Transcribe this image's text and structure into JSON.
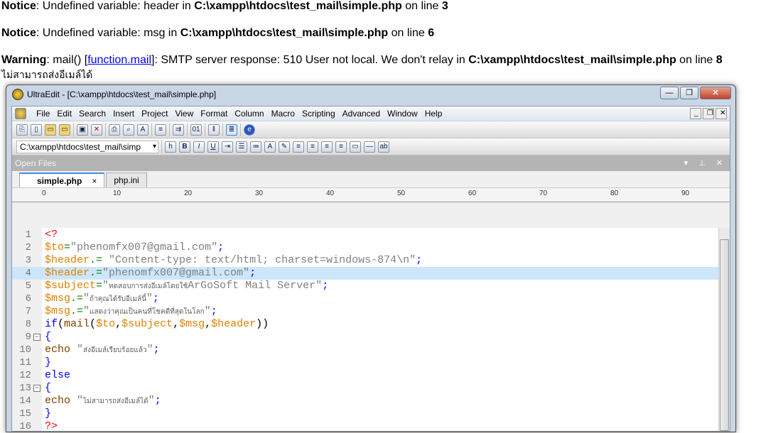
{
  "php_output": {
    "notices": [
      {
        "level": "Notice",
        "message": ": Undefined variable: header in ",
        "path": "C:\\xampp\\htdocs\\test_mail\\simple.php",
        "on_line": " on line ",
        "line": "3"
      },
      {
        "level": "Notice",
        "message": ": Undefined variable: msg in ",
        "path": "C:\\xampp\\htdocs\\test_mail\\simple.php",
        "on_line": " on line ",
        "line": "6"
      }
    ],
    "warning": {
      "level": "Warning",
      "pre": ": mail() [",
      "link": "function.mail",
      "post": "]: SMTP server response: 510 User not local. We don't relay in ",
      "path": "C:\\xampp\\htdocs\\test_mail\\simple.php",
      "on_line": " on line ",
      "line": "8"
    },
    "echo_text": "ไม่สามารถส่งอีเมล์ได้"
  },
  "window": {
    "title": "UltraEdit - [C:\\xampp\\htdocs\\test_mail\\simple.php]",
    "min": "—",
    "max": "❐",
    "close": "✕"
  },
  "menu": [
    "File",
    "Edit",
    "Search",
    "Insert",
    "Project",
    "View",
    "Format",
    "Column",
    "Macro",
    "Scripting",
    "Advanced",
    "Window",
    "Help"
  ],
  "mdi": [
    "_",
    "❐",
    "✕"
  ],
  "toolbar": {
    "path_value": "C:\\xampp\\htdocs\\test_mail\\simp"
  },
  "open_files": {
    "title": "Open Files",
    "controls": "▾ ⊥ ✕"
  },
  "tabs": [
    {
      "label": "simple.php",
      "active": true,
      "close": "×"
    },
    {
      "label": "php.ini",
      "active": false
    }
  ],
  "ruler": [
    "0",
    "10",
    "20",
    "30",
    "40",
    "50",
    "60",
    "70",
    "80",
    "90"
  ],
  "code": [
    [
      [
        "tag",
        "<?"
      ]
    ],
    [
      [
        "var",
        "$to"
      ],
      [
        "op",
        "="
      ],
      [
        "str",
        "\"phenomfx007@gmail.com\""
      ],
      [
        "punc",
        ";"
      ]
    ],
    [
      [
        "var",
        "$header"
      ],
      [
        "op",
        ".="
      ],
      [
        "str",
        " \"Content-type: text/html; charset=windows-874\\n\""
      ],
      [
        "punc",
        ";"
      ]
    ],
    [
      [
        "var",
        "$header"
      ],
      [
        "op",
        ".="
      ],
      [
        "str",
        "\"phenomfx007@gmail.com\""
      ],
      [
        "punc",
        ";"
      ]
    ],
    [
      [
        "var",
        "$subject"
      ],
      [
        "op",
        "="
      ],
      [
        "str",
        "\""
      ],
      [
        "th",
        "ทดสอบการส่งอีเมล์โดยใช้"
      ],
      [
        "str",
        "ArGoSoft Mail Server\""
      ],
      [
        "punc",
        ";"
      ]
    ],
    [
      [
        "var",
        "$msg"
      ],
      [
        "op",
        ".="
      ],
      [
        "str",
        "\""
      ],
      [
        "th",
        "ถ้าคุณได้รับอีเมล์นี้"
      ],
      [
        "str",
        "\""
      ],
      [
        "punc",
        ";"
      ]
    ],
    [
      [
        "var",
        "$msg"
      ],
      [
        "op",
        ".="
      ],
      [
        "str",
        "\""
      ],
      [
        "th",
        "แสดงว่าคุณเป็นคนที่โชคดีที่สุดในโลก"
      ],
      [
        "str",
        "\""
      ],
      [
        "punc",
        ";"
      ]
    ],
    [
      [
        "kw",
        "if"
      ],
      [
        "plain",
        "("
      ],
      [
        "fn",
        "mail"
      ],
      [
        "plain",
        "("
      ],
      [
        "var",
        "$to"
      ],
      [
        "plain",
        ","
      ],
      [
        "var",
        "$subject"
      ],
      [
        "plain",
        ","
      ],
      [
        "var",
        "$msg"
      ],
      [
        "plain",
        ","
      ],
      [
        "var",
        "$header"
      ],
      [
        "plain",
        "))"
      ]
    ],
    [
      [
        "kw",
        "{"
      ]
    ],
    [
      [
        "fn",
        "echo "
      ],
      [
        "str",
        "\""
      ],
      [
        "th",
        "ส่งอีเมล์เรียบร้อยแล้ว"
      ],
      [
        "str",
        "\""
      ],
      [
        "punc",
        ";"
      ]
    ],
    [
      [
        "kw",
        "}"
      ]
    ],
    [
      [
        "kw",
        "else"
      ]
    ],
    [
      [
        "kw",
        "{"
      ]
    ],
    [
      [
        "fn",
        "echo "
      ],
      [
        "str",
        "\""
      ],
      [
        "th",
        "ไม่สามารถส่งอีเมล์ได้"
      ],
      [
        "str",
        "\""
      ],
      [
        "punc",
        ";"
      ]
    ],
    [
      [
        "kw",
        "}"
      ]
    ],
    [
      [
        "tag",
        "?>"
      ]
    ]
  ],
  "highlighted_line": 4,
  "fold_lines": [
    9,
    13
  ]
}
